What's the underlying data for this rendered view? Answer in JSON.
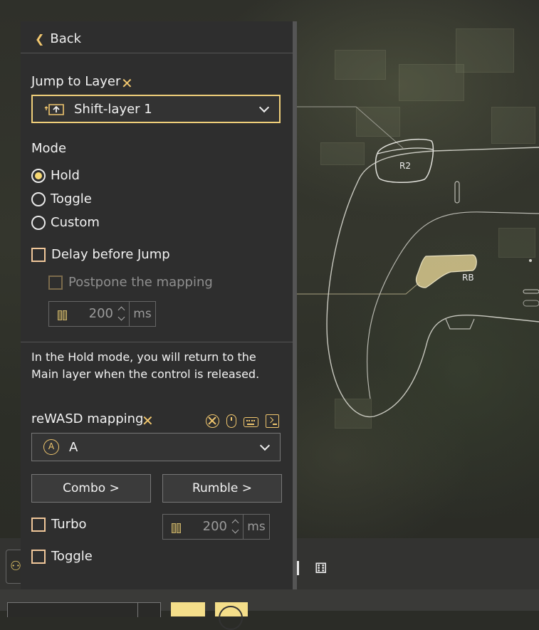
{
  "panel": {
    "back_label": "Back",
    "jump_title": "Jump to Layer",
    "layer_select_value": "Shift-layer 1",
    "mode_title": "Mode",
    "modes": [
      {
        "label": "Hold",
        "selected": true
      },
      {
        "label": "Toggle",
        "selected": false
      },
      {
        "label": "Custom",
        "selected": false
      }
    ],
    "delay_label": "Delay before Jump",
    "delay_checked": false,
    "postpone_label": "Postpone the mapping",
    "postpone_checked": false,
    "delay_value": "200",
    "delay_unit": "ms",
    "description": "In the Hold mode, you will return to the Main layer when the control is released.",
    "mapping_title": "reWASD mapping",
    "mapping_source_icons": [
      "gamepad-icon",
      "mouse-icon",
      "keyboard-icon",
      "terminal-icon"
    ],
    "mapping_badge": "A",
    "mapping_value": "A",
    "combo_label": "Combo >",
    "rumble_label": "Rumble >",
    "turbo_label": "Turbo",
    "turbo_checked": false,
    "turbo_value": "200",
    "turbo_unit": "ms",
    "toggle_label": "Toggle",
    "toggle_checked": false
  },
  "controller": {
    "buttons": [
      {
        "id": "r2",
        "label": "R2"
      },
      {
        "id": "rb",
        "label": "RB",
        "highlighted": true
      }
    ]
  },
  "colors": {
    "accent": "#f0c66e",
    "panel_bg": "#2e2e2e",
    "highlight_fill": "#d8c98e"
  }
}
